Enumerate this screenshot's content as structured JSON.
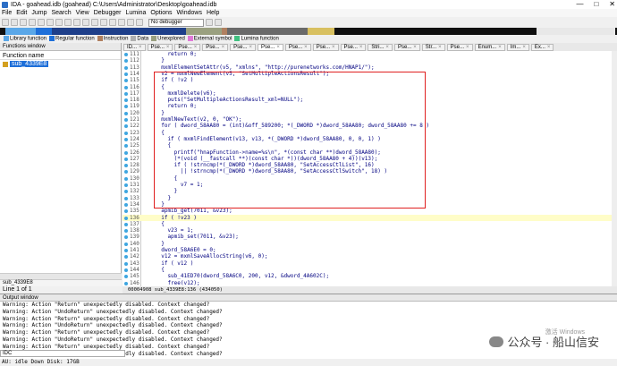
{
  "window": {
    "title": "IDA - goahead.idb (goahead) C:\\Users\\Administrator\\Desktop\\goahead.idb",
    "controls": [
      "—",
      "□",
      "✕"
    ]
  },
  "menu": [
    "File",
    "Edit",
    "Jump",
    "Search",
    "View",
    "Debugger",
    "Lumina",
    "Options",
    "Windows",
    "Help"
  ],
  "toolbar": {
    "debugger_select": "No debugger"
  },
  "legend": [
    {
      "label": "Library function",
      "color": "#5aa7e8"
    },
    {
      "label": "Regular function",
      "color": "#1e6fd9"
    },
    {
      "label": "Instruction",
      "color": "#b08060"
    },
    {
      "label": "Data",
      "color": "#b0b0b0"
    },
    {
      "label": "Unexplored",
      "color": "#9aa080"
    },
    {
      "label": "External symbol",
      "color": "#e07ad8"
    },
    {
      "label": "Lumina function",
      "color": "#40c080"
    }
  ],
  "functions_window": {
    "title": "Functions window",
    "header": "Function name",
    "items": [
      "sub_4339E8"
    ],
    "sub_label": "sub_4339E8",
    "status": "Line 1 of 1"
  },
  "tabs": [
    "ID...",
    "Pse...",
    "Pse...",
    "Pse...",
    "Pse...",
    "Pse...",
    "Pse...",
    "Pse...",
    "Pse...",
    "Stri...",
    "Pse...",
    "Str...",
    "Pse...",
    "Enum...",
    "Im...",
    "Ex..."
  ],
  "code_lines": [
    {
      "ln": "111",
      "code": "    return 0;"
    },
    {
      "ln": "112",
      "code": "  }"
    },
    {
      "ln": "113",
      "code": "  mxmlElementSetAttr(v5, \"xmlns\", \"http://purenetworks.com/HNAP1/\");"
    },
    {
      "ln": "114",
      "code": "  v2 = mxmlNewElement(v5, \"SetMultipleActionsResult\");"
    },
    {
      "ln": "115",
      "code": "  if ( !v2 )"
    },
    {
      "ln": "116",
      "code": "  {"
    },
    {
      "ln": "117",
      "code": "    mxmlDelete(v6);"
    },
    {
      "ln": "118",
      "code": "    puts(\"SetMultipleActionsResult_xml=NULL\");"
    },
    {
      "ln": "119",
      "code": "    return 0;"
    },
    {
      "ln": "120",
      "code": "  }"
    },
    {
      "ln": "121",
      "code": "  mxmlNewText(v2, 0, \"OK\");"
    },
    {
      "ln": "122",
      "code": "  for ( dword_58AA80 = (int)&off_589200; *(_DWORD *)dword_58AA80; dword_58AA80 += 8 )"
    },
    {
      "ln": "123",
      "code": "  {"
    },
    {
      "ln": "124",
      "code": "    if ( mxmlFindElement(v13, v13, *(_DWORD *)dword_58AA80, 0, 0, 1) )"
    },
    {
      "ln": "125",
      "code": "    {"
    },
    {
      "ln": "126",
      "code": "      printf(\"hnapFunction->name=%s\\n\", *(const char **)dword_58AA80);"
    },
    {
      "ln": "127",
      "code": "      (*(void (__fastcall **)(const char *))(dword_58AA80 + 4))(v13);"
    },
    {
      "ln": "128",
      "code": "      if ( !strncmp(*(_DWORD *)dword_58AA80, \"SetAccessCtlList\", 16)"
    },
    {
      "ln": "129",
      "code": "        || !strncmp(*(_DWORD *)dword_58AA80, \"SetAccessCtlSwitch\", 18) )"
    },
    {
      "ln": "130",
      "code": "      {"
    },
    {
      "ln": "131",
      "code": "        v7 = 1;"
    },
    {
      "ln": "132",
      "code": "      }"
    },
    {
      "ln": "133",
      "code": "    }"
    },
    {
      "ln": "134",
      "code": "  }"
    },
    {
      "ln": "135",
      "code": "  apmib_get(7011, &v23);"
    },
    {
      "ln": "136",
      "code": "  if ( !v23 )"
    },
    {
      "ln": "137",
      "code": "  {"
    },
    {
      "ln": "138",
      "code": "    v23 = 1;"
    },
    {
      "ln": "139",
      "code": "    apmib_set(7011, &v23);"
    },
    {
      "ln": "140",
      "code": "  }"
    },
    {
      "ln": "141",
      "code": "  dword_58A6E0 = 0;"
    },
    {
      "ln": "142",
      "code": "  v12 = mxmlSaveAllocString(v6, 0);"
    },
    {
      "ln": "143",
      "code": "  if ( v12 )"
    },
    {
      "ln": "144",
      "code": "  {"
    },
    {
      "ln": "145",
      "code": "    sub_41ED70(dword_58A6C0, 200, v12, &dword_4A602C);"
    },
    {
      "ln": "146",
      "code": "    free(v12);"
    }
  ],
  "editor_status": "00004908 sub_4339E8:136 (434050)",
  "output": {
    "title": "Output window",
    "lines": [
      "Warning: Action \"Return\" unexpectedly disabled. Context changed?",
      "Warning: Action \"UndoReturn\" unexpectedly disabled. Context changed?",
      "Warning: Action \"Return\" unexpectedly disabled. Context changed?",
      "Warning: Action \"UndoReturn\" unexpectedly disabled. Context changed?",
      "Warning: Action \"Return\" unexpectedly disabled. Context changed?",
      "Warning: Action \"UndoReturn\" unexpectedly disabled. Context changed?",
      "Warning: Action \"Return\" unexpectedly disabled. Context changed?",
      "Warning: Action \"UndoReturn\" unexpectedly disabled. Context changed?"
    ],
    "idc_label": "IDC"
  },
  "statusbar": "AU:  idle   Down    Disk: 17GB",
  "watermark": {
    "text": "公众号 · 船山信安",
    "faint": "激活 Windows"
  }
}
